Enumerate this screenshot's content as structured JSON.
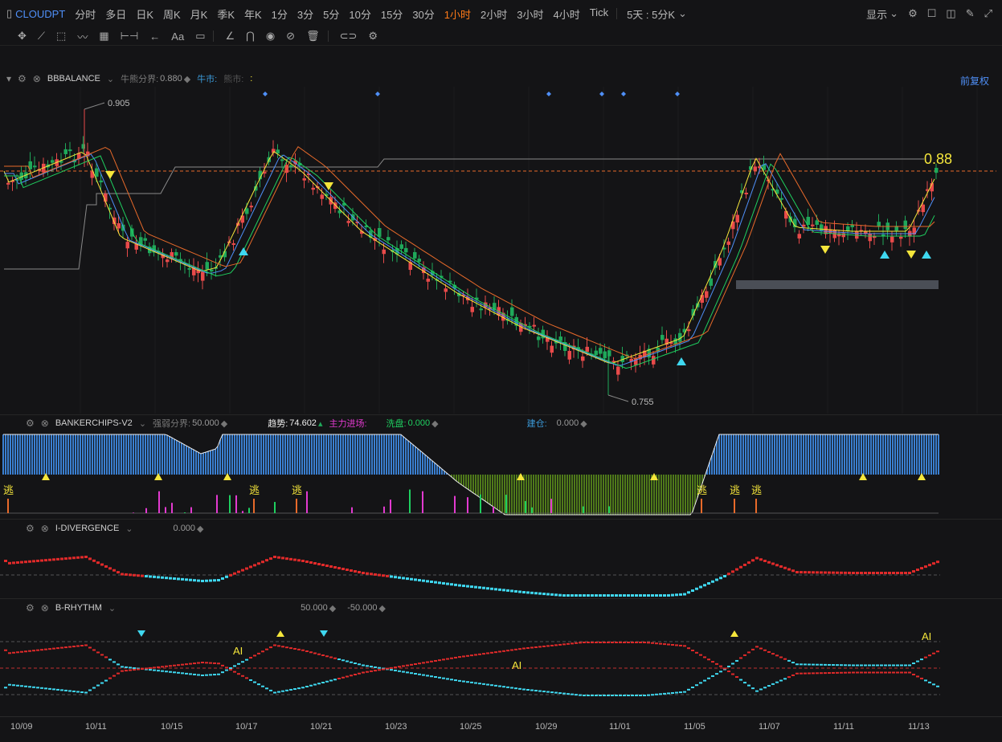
{
  "toolbar": {
    "symbol": "CLOUDPT",
    "periods": [
      "分时",
      "多日",
      "日K",
      "周K",
      "月K",
      "季K",
      "年K",
      "1分",
      "3分",
      "5分",
      "10分",
      "15分",
      "30分",
      "1小时",
      "2小时",
      "3小时",
      "4小时",
      "Tick"
    ],
    "active_period": "1小时",
    "multi": "5天 : 5分K",
    "display": "显示",
    "drawing_text_tool": "Aa"
  },
  "main_pane": {
    "indicator": "BBBALANCE",
    "param_label": "牛熊分界:",
    "param_value": "0.880",
    "bull": "牛市:",
    "bear": "熊市:",
    "colon": ":",
    "adjust": "前复权",
    "high_label": "0.905",
    "low_label": "0.755",
    "level_label": "0.88"
  },
  "pane2": {
    "indicator": "BANKERCHIPS-V2",
    "param_label": "强弱分界:",
    "param_value": "50.000",
    "trend_label": "趋势:",
    "trend_value": "74.602",
    "main_in": "主力进场:",
    "wash_label": "洗盘:",
    "wash_value": "0.000",
    "build_label": "建仓:",
    "build_value": "0.000",
    "escape": "逃"
  },
  "pane3": {
    "indicator": "I-DIVERGENCE",
    "value": "0.000"
  },
  "pane4": {
    "indicator": "B-RHYTHM",
    "v1": "50.000",
    "v2": "-50.000",
    "ai": "AI"
  },
  "xaxis": [
    "10/09",
    "10/11",
    "10/15",
    "10/17",
    "10/21",
    "10/23",
    "10/25",
    "10/29",
    "11/01",
    "11/05",
    "11/07",
    "11/11",
    "11/13"
  ],
  "colors": {
    "up": "#e84a4a",
    "down": "#1fa85a",
    "accent": "#4f8ff7",
    "active": "#ff7a18",
    "yellow": "#f5e63b"
  },
  "chart_data": {
    "type": "line",
    "title": "CLOUDPT 1小时",
    "x": [
      "10/09",
      "10/11",
      "10/15",
      "10/17",
      "10/21",
      "10/23",
      "10/25",
      "10/29",
      "11/01",
      "11/05",
      "11/07",
      "11/11",
      "11/13"
    ],
    "series": [
      {
        "values": [
          0.862,
          0.878,
          0.835,
          0.852,
          0.875,
          0.84,
          0.812,
          0.788,
          0.772,
          0.792,
          0.875,
          0.85,
          0.868
        ]
      }
    ],
    "extremes": {
      "high": 0.905,
      "low": 0.755
    },
    "levels": [
      0.88
    ],
    "ylim": [
      0.75,
      0.91
    ]
  }
}
